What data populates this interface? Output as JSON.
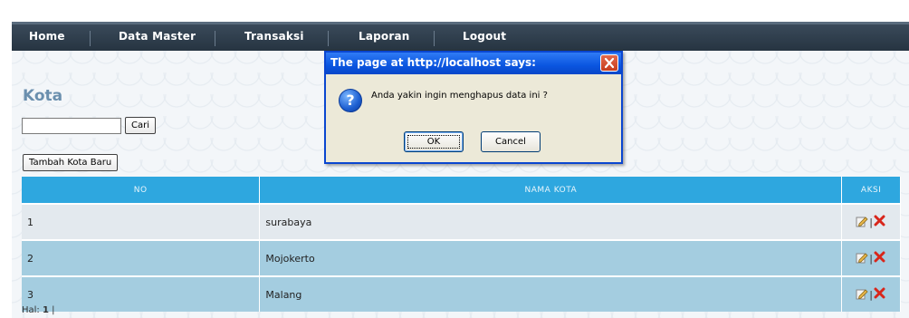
{
  "nav": {
    "items": [
      "Home",
      "Data Master",
      "Transaksi",
      "Laporan",
      "Logout"
    ]
  },
  "page": {
    "title": "Kota",
    "search_value": "",
    "search_button": "Cari",
    "add_button": "Tambah Kota Baru"
  },
  "table": {
    "headers": {
      "no": "NO",
      "nama": "NAMA KOTA",
      "aksi": "AKSI"
    },
    "rows": [
      {
        "no": "1",
        "nama": "surabaya"
      },
      {
        "no": "2",
        "nama": "Mojokerto"
      },
      {
        "no": "3",
        "nama": "Malang"
      }
    ]
  },
  "pager": {
    "label": "Hal:",
    "current": "1",
    "separator": "|"
  },
  "dialog": {
    "title": "The page at http://localhost says:",
    "message": "Anda yakin ingin menghapus data ini ?",
    "ok_label": "OK",
    "cancel_label": "Cancel",
    "icon": "question-icon"
  },
  "colors": {
    "nav_bg": "#2b3947",
    "table_header": "#2ea7df",
    "row_odd": "#e3e9ee",
    "row_even": "#a4cde0",
    "title": "#6a8fae",
    "dialog_titlebar": "#0a55e0"
  }
}
